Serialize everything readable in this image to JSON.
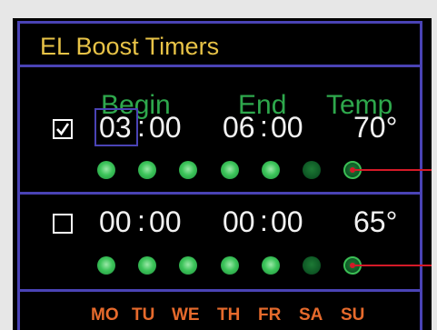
{
  "title": "EL Boost Timers",
  "headers": {
    "begin": "Begin",
    "end": "End",
    "temp": "Temp"
  },
  "timers": [
    {
      "enabled": true,
      "begin_hour": "03",
      "begin_min": "00",
      "end_hour": "06",
      "end_min": "00",
      "temp": "70°",
      "days_active": [
        true,
        true,
        true,
        true,
        true,
        false,
        false
      ]
    },
    {
      "enabled": false,
      "begin_hour": "00",
      "begin_min": "00",
      "end_hour": "00",
      "end_min": "00",
      "temp": "65°",
      "days_active": [
        true,
        true,
        true,
        true,
        true,
        false,
        false
      ]
    }
  ],
  "time_separator": ":",
  "days": [
    "MO",
    "TU",
    "WE",
    "TH",
    "FR",
    "SA",
    "SU"
  ],
  "colors": {
    "frame": "#4a43b5",
    "title": "#e8c347",
    "header": "#2ea84c",
    "days": "#e66a2c",
    "dot_on": "#3cc45a",
    "dot_off": "#0f5a26",
    "callout": "#d41a28"
  },
  "icons": {
    "checked": "check-mark-icon",
    "selected_field": "focus-box"
  }
}
